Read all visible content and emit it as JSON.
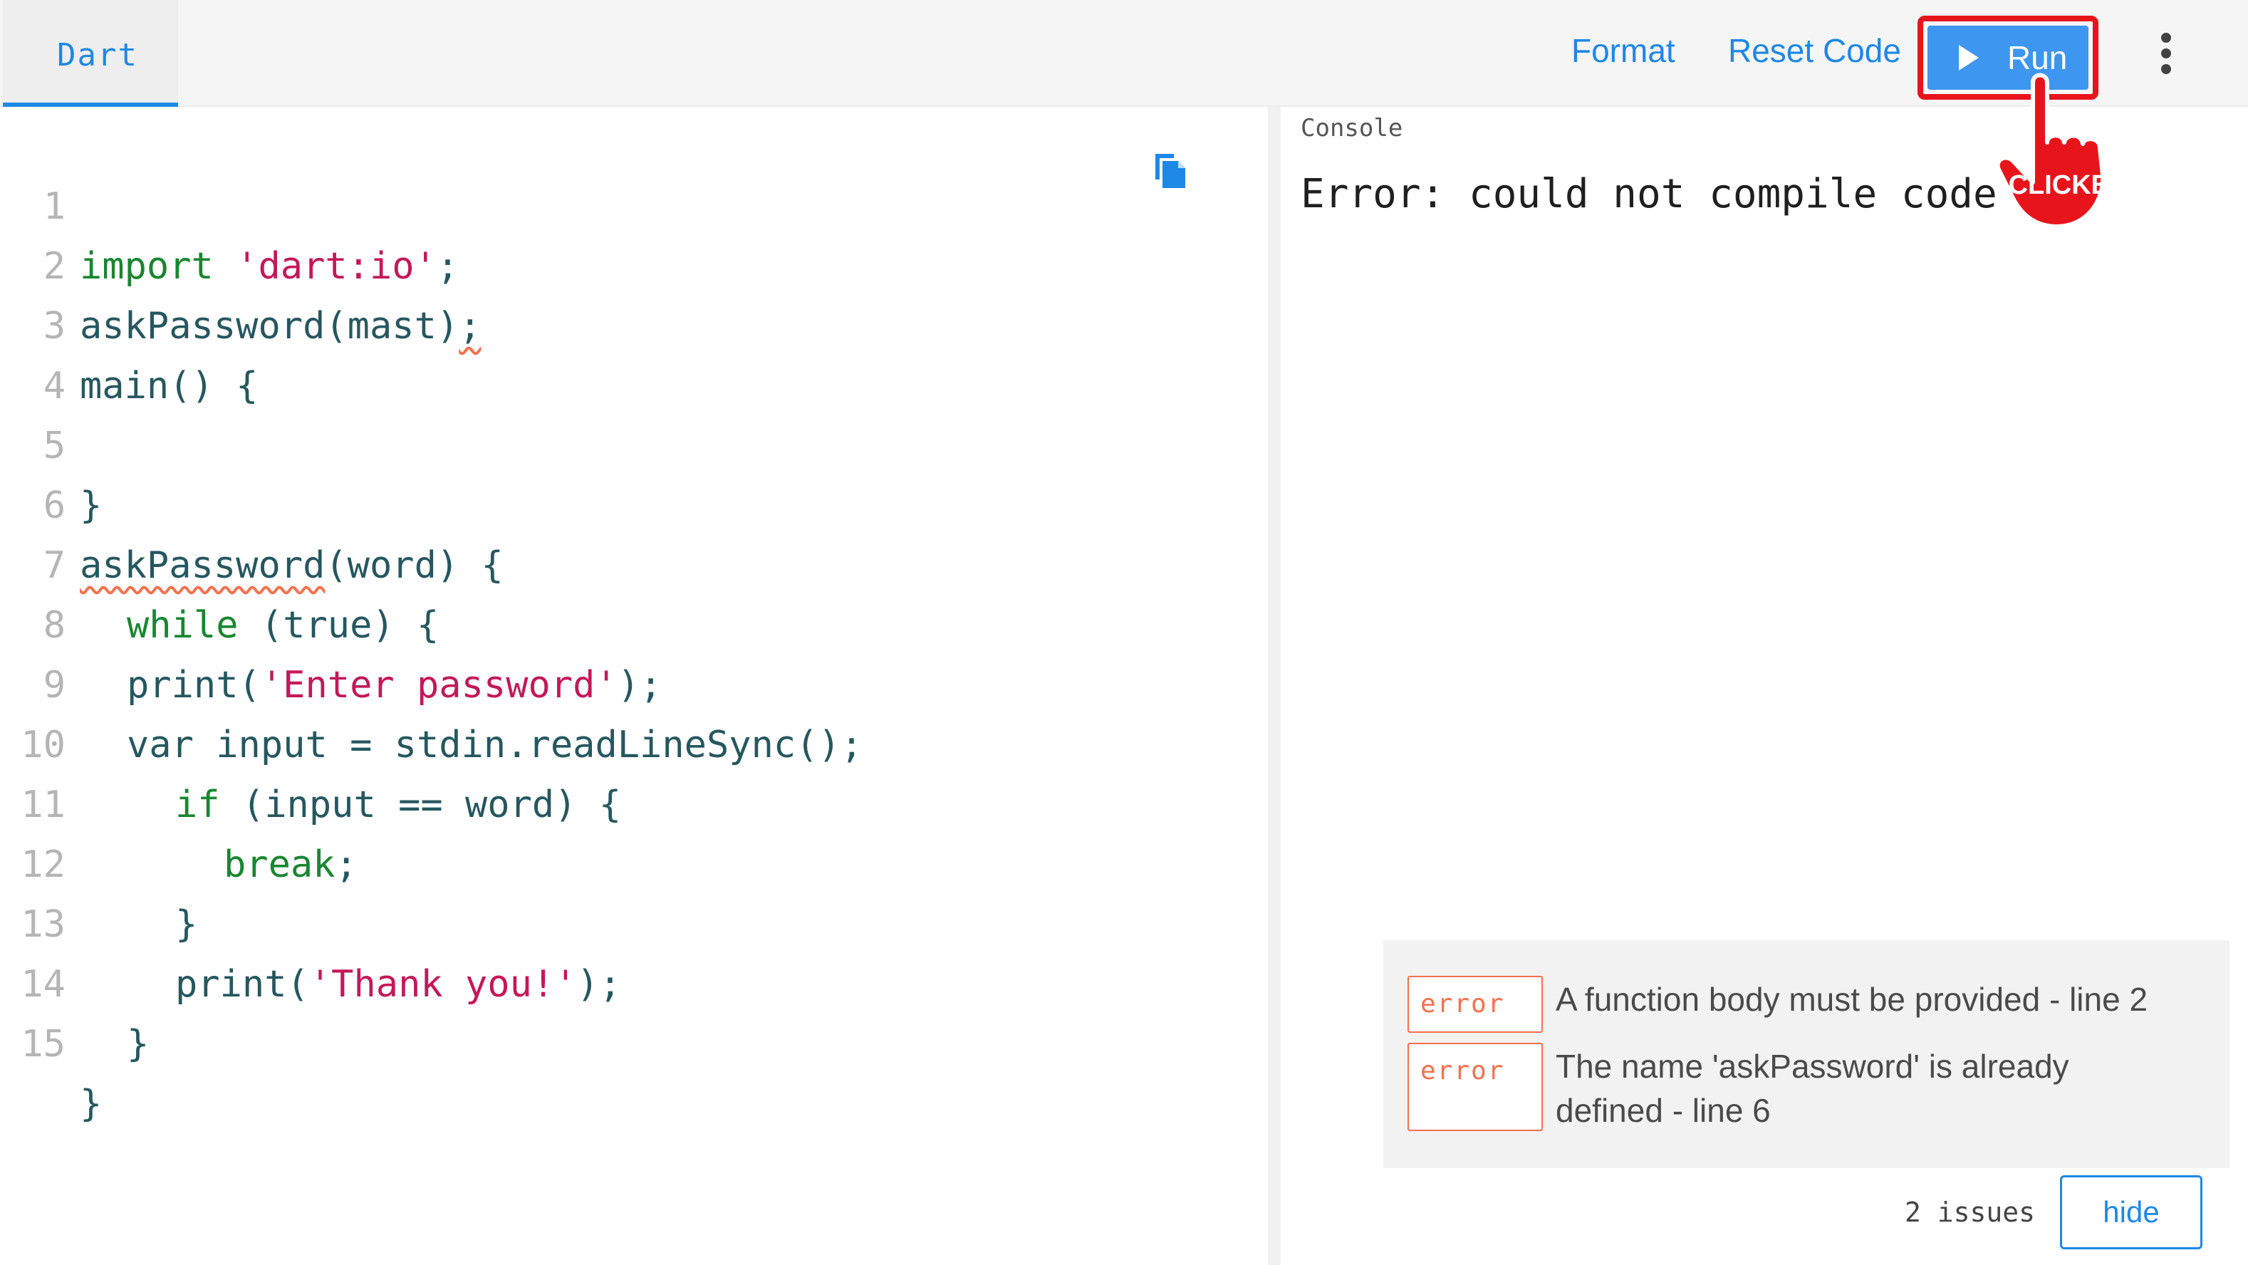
{
  "tab": {
    "label": "Dart"
  },
  "toolbar": {
    "format_label": "Format",
    "reset_label": "Reset Code",
    "run_label": "Run"
  },
  "annotation": {
    "label": "CLICKED"
  },
  "editor": {
    "lines": [
      {
        "n": "1"
      },
      {
        "n": "2"
      },
      {
        "n": "3"
      },
      {
        "n": "4"
      },
      {
        "n": "5"
      },
      {
        "n": "6"
      },
      {
        "n": "7"
      },
      {
        "n": "8"
      },
      {
        "n": "9"
      },
      {
        "n": "10"
      },
      {
        "n": "11"
      },
      {
        "n": "12"
      },
      {
        "n": "13"
      },
      {
        "n": "14"
      },
      {
        "n": "15"
      }
    ],
    "tokens": {
      "import": "import",
      "dart_io": "'dart:io'",
      "semicolon": ";",
      "ask_call": "askPassword(mast)",
      "main": "main() {",
      "close_brace": "}",
      "ask_decl": "askPassword",
      "ask_params": "(word) {",
      "while": "while",
      "while_rest": " (true) {",
      "print_open": "print(",
      "enter_pw": "'Enter password'",
      "print_close": ");",
      "var": "var",
      "var_rest": " input = stdin.readLineSync();",
      "if": "if",
      "if_rest": " (input == word) {",
      "break": "break",
      "thank_you": "'Thank you!'"
    }
  },
  "console": {
    "title": "Console",
    "output": "Error: could not compile code"
  },
  "issues": {
    "items": [
      {
        "type": "error",
        "text": "A function body must be provided - line 2"
      },
      {
        "type": "error",
        "text": "The name 'askPassword' is already defined - line 6"
      }
    ],
    "count_label": "2 issues",
    "hide_label": "hide"
  },
  "colors": {
    "accent": "#1e88e5",
    "run_button": "#3d96ef",
    "highlight_red": "#e8141c",
    "error": "#f4714e"
  },
  "icons": [
    "play-icon",
    "more-vert-icon",
    "copy-icon",
    "pointer-hand-icon"
  ]
}
